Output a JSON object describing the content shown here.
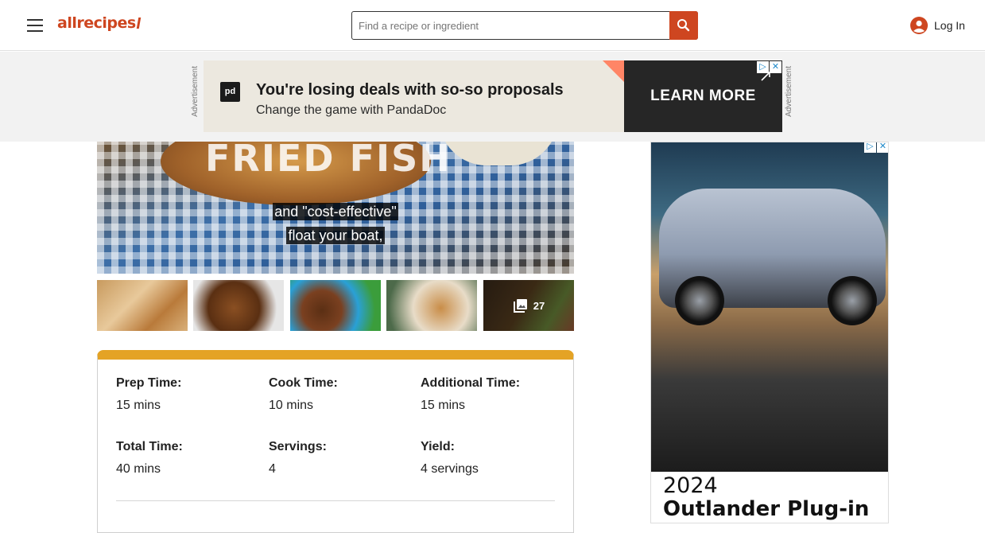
{
  "header": {
    "menu_icon": "hamburger-menu-icon",
    "logo_text": "allrecipes",
    "search": {
      "placeholder": "Find a recipe or ingredient",
      "value": "",
      "button_icon": "search-icon"
    },
    "login_label": "Log In",
    "login_icon": "account-circle-icon"
  },
  "top_ad": {
    "side_label": "Advertisement",
    "brand_logo_text": "pd",
    "headline": "You're losing deals with so-so proposals",
    "subline": "Change the game with PandaDoc",
    "cta": "LEARN MORE",
    "adchoices_icon": "adchoices-icon",
    "close_icon": "close-icon"
  },
  "video": {
    "overlay_title": "FRIED FISH",
    "caption_lines": [
      "and \"cost-effective\"",
      "float your boat,"
    ]
  },
  "gallery": {
    "thumbnails": [
      "thumbnail-1",
      "thumbnail-2",
      "thumbnail-3",
      "thumbnail-4"
    ],
    "more_icon": "photo-gallery-icon",
    "more_count": "27"
  },
  "recipe_details": {
    "items": [
      {
        "label": "Prep Time:",
        "value": "15 mins"
      },
      {
        "label": "Cook Time:",
        "value": "10 mins"
      },
      {
        "label": "Additional Time:",
        "value": "15 mins"
      },
      {
        "label": "Total Time:",
        "value": "40 mins"
      },
      {
        "label": "Servings:",
        "value": "4"
      },
      {
        "label": "Yield:",
        "value": "4 servings"
      }
    ],
    "accent_color": "#e4a325"
  },
  "side_ad": {
    "year": "2024",
    "model": "Outlander Plug-in",
    "adchoices_icon": "adchoices-icon",
    "close_icon": "close-icon"
  },
  "colors": {
    "brand": "#ce4620"
  }
}
